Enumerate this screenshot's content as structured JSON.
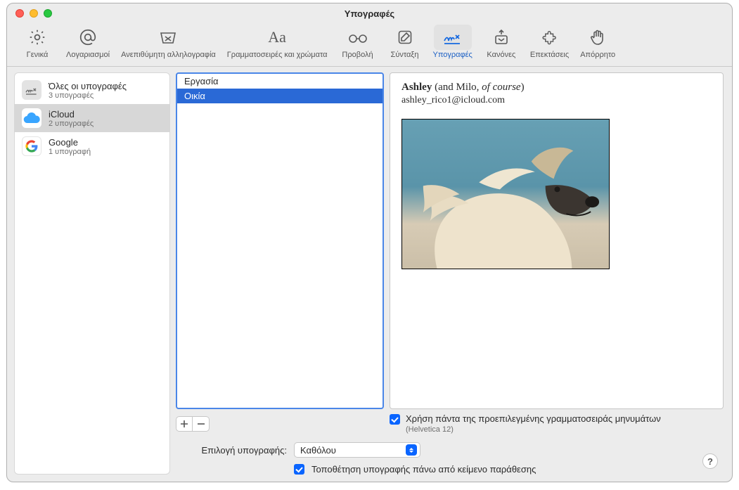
{
  "window": {
    "title": "Υπογραφές"
  },
  "toolbar": {
    "items": [
      {
        "label": "Γενικά"
      },
      {
        "label": "Λογαριασμοί"
      },
      {
        "label": "Ανεπιθύμητη αλληλογραφία"
      },
      {
        "label": "Γραμματοσειρές και χρώματα"
      },
      {
        "label": "Προβολή"
      },
      {
        "label": "Σύνταξη"
      },
      {
        "label": "Υπογραφές"
      },
      {
        "label": "Κανόνες"
      },
      {
        "label": "Επεκτάσεις"
      },
      {
        "label": "Απόρρητο"
      }
    ],
    "selected_index": 6
  },
  "accounts": [
    {
      "name": "Όλες οι υπογραφές",
      "sub": "3 υπογραφές",
      "icon": "signatures"
    },
    {
      "name": "iCloud",
      "sub": "2 υπογραφές",
      "icon": "icloud"
    },
    {
      "name": "Google",
      "sub": "1 υπογραφή",
      "icon": "google"
    }
  ],
  "accounts_selected_index": 1,
  "signatures": [
    {
      "name": "Εργασία"
    },
    {
      "name": "Οικία"
    }
  ],
  "signatures_selected_index": 1,
  "preview": {
    "name_bold": "Ashley",
    "name_rest": " (and Milo, ",
    "name_italic": "of course",
    "name_close": ")",
    "email": "ashley_rico1@icloud.com"
  },
  "default_font_checkbox": {
    "checked": true,
    "label": "Χρήση πάντα της προεπιλεγμένης γραμματοσειράς μηνυμάτων",
    "sub": "(Helvetica 12)"
  },
  "choose_signature": {
    "label": "Επιλογή υπογραφής:",
    "value": "Καθόλου"
  },
  "above_quoted_checkbox": {
    "checked": true,
    "label": "Τοποθέτηση υπογραφής πάνω από κείμενο παράθεσης"
  },
  "help_glyph": "?"
}
